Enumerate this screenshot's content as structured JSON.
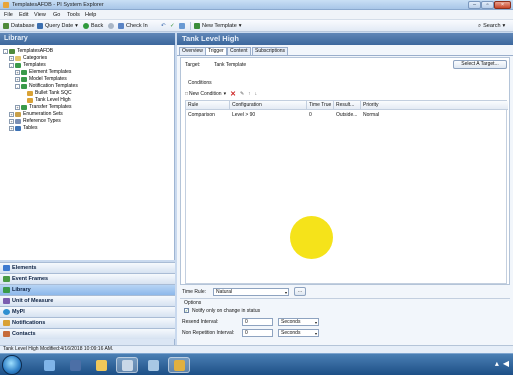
{
  "window": {
    "title": "TemplatesAFDB - PI System Explorer",
    "controls": [
      "minimize",
      "maximize",
      "close"
    ]
  },
  "menu": [
    "File",
    "Edit",
    "View",
    "Go",
    "Tools",
    "Help"
  ],
  "toolbar": {
    "database": "Database",
    "query_date": "Query Date",
    "back": "Back",
    "check_in": "Check In",
    "new_template": "New Template",
    "search": "Search"
  },
  "library": {
    "header": "Library",
    "tree": [
      {
        "label": "TemplatesAFDB",
        "level": 0,
        "expander": "-",
        "icon": "database-icon"
      },
      {
        "label": "Categories",
        "level": 1,
        "expander": "+",
        "icon": "folder-icon"
      },
      {
        "label": "Templates",
        "level": 1,
        "expander": "-",
        "icon": "templates-icon"
      },
      {
        "label": "Element Templates",
        "level": 2,
        "expander": "+",
        "icon": "element-template-icon"
      },
      {
        "label": "Model Templates",
        "level": 2,
        "expander": "+",
        "icon": "model-template-icon"
      },
      {
        "label": "Notification Templates",
        "level": 2,
        "expander": "-",
        "icon": "notification-template-icon"
      },
      {
        "label": "Bullet Tank SQC",
        "level": 3,
        "expander": "",
        "icon": "notification-icon"
      },
      {
        "label": "Tank Level High",
        "level": 3,
        "expander": "",
        "icon": "notification-icon"
      },
      {
        "label": "Transfer Templates",
        "level": 2,
        "expander": "+",
        "icon": "transfer-template-icon"
      },
      {
        "label": "Enumeration Sets",
        "level": 1,
        "expander": "+",
        "icon": "enumeration-icon"
      },
      {
        "label": "Reference Types",
        "level": 1,
        "expander": "+",
        "icon": "reference-icon"
      },
      {
        "label": "Tables",
        "level": 1,
        "expander": "+",
        "icon": "table-icon"
      }
    ]
  },
  "nav": [
    {
      "label": "Elements",
      "icon": "elements-icon",
      "selected": false
    },
    {
      "label": "Event Frames",
      "icon": "event-frames-icon",
      "selected": false
    },
    {
      "label": "Library",
      "icon": "library-icon",
      "selected": true
    },
    {
      "label": "Unit of Measure",
      "icon": "unit-of-measure-icon",
      "selected": false
    },
    {
      "label": "MyPI",
      "icon": "mypi-icon",
      "selected": false
    },
    {
      "label": "Notifications",
      "icon": "notifications-icon",
      "selected": false
    },
    {
      "label": "Contacts",
      "icon": "contacts-icon",
      "selected": false
    }
  ],
  "detail": {
    "header": "Tank Level High",
    "tabs": [
      "Overview",
      "Trigger",
      "Content",
      "Subscriptions"
    ],
    "active_tab": "Trigger",
    "target_label": "Target:",
    "target_value": "Tank Template",
    "select_target": "Select A Target...",
    "conditions_label": "Conditions",
    "new_condition": "New Condition",
    "columns": [
      "Rule",
      "Configuration",
      "Time True",
      "Result...",
      "Priority"
    ],
    "rows": [
      {
        "rule": "Comparison",
        "configuration": "Level > 90",
        "time_true": "0",
        "result": "Outside...",
        "priority": "Normal"
      }
    ],
    "time_rule_label": "Time Rule:",
    "time_rule_value": "Natural",
    "options_label": "Options",
    "notify_only_label": "Notify only on change in status",
    "notify_only_checked": true,
    "resend_label": "Resend Interval:",
    "resend_value": "0",
    "resend_unit": "Seconds",
    "non_repetition_label": "Non Repetition Interval:",
    "non_repetition_value": "0",
    "non_repetition_unit": "Seconds"
  },
  "status": "Tank Level High  Modified:4/16/2018 10:09:16 AM.",
  "colors": {
    "accent_header": "#3c679c",
    "highlight": "#f5e31a",
    "taskbar": "#1d4f86"
  }
}
